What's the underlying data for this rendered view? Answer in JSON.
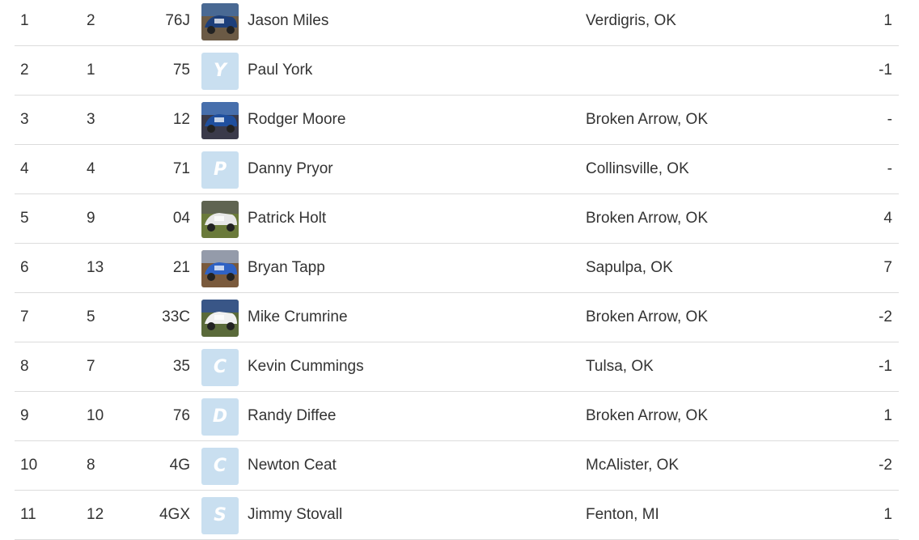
{
  "standings": {
    "rows": [
      {
        "position": "1",
        "previous": "2",
        "car": "76J",
        "avatar_type": "photo",
        "avatar_icon": "car-photo-icon",
        "name": "Jason Miles",
        "hometown": "Verdigris, OK",
        "change": "1"
      },
      {
        "position": "2",
        "previous": "1",
        "car": "75",
        "avatar_type": "letter",
        "avatar_letter": "Y",
        "name": "Paul York",
        "hometown": "",
        "change": "-1"
      },
      {
        "position": "3",
        "previous": "3",
        "car": "12",
        "avatar_type": "photo",
        "avatar_icon": "car-photo-icon",
        "name": "Rodger Moore",
        "hometown": "Broken Arrow, OK",
        "change": "-"
      },
      {
        "position": "4",
        "previous": "4",
        "car": "71",
        "avatar_type": "letter",
        "avatar_letter": "P",
        "name": "Danny Pryor",
        "hometown": "Collinsville, OK",
        "change": "-"
      },
      {
        "position": "5",
        "previous": "9",
        "car": "04",
        "avatar_type": "photo",
        "avatar_icon": "car-photo-icon",
        "name": "Patrick Holt",
        "hometown": "Broken Arrow, OK",
        "change": "4"
      },
      {
        "position": "6",
        "previous": "13",
        "car": "21",
        "avatar_type": "photo",
        "avatar_icon": "car-photo-icon",
        "name": "Bryan Tapp",
        "hometown": "Sapulpa, OK",
        "change": "7"
      },
      {
        "position": "7",
        "previous": "5",
        "car": "33C",
        "avatar_type": "photo",
        "avatar_icon": "car-photo-icon",
        "name": "Mike Crumrine",
        "hometown": "Broken Arrow, OK",
        "change": "-2"
      },
      {
        "position": "8",
        "previous": "7",
        "car": "35",
        "avatar_type": "letter",
        "avatar_letter": "C",
        "name": "Kevin Cummings",
        "hometown": "Tulsa, OK",
        "change": "-1"
      },
      {
        "position": "9",
        "previous": "10",
        "car": "76",
        "avatar_type": "letter",
        "avatar_letter": "D",
        "name": "Randy Diffee",
        "hometown": "Broken Arrow, OK",
        "change": "1"
      },
      {
        "position": "10",
        "previous": "8",
        "car": "4G",
        "avatar_type": "letter",
        "avatar_letter": "C",
        "name": "Newton Ceat",
        "hometown": "McAlister, OK",
        "change": "-2"
      },
      {
        "position": "11",
        "previous": "12",
        "car": "4GX",
        "avatar_type": "letter",
        "avatar_letter": "S",
        "name": "Jimmy Stovall",
        "hometown": "Fenton, MI",
        "change": "1"
      }
    ]
  },
  "colors": {
    "text": "#333333",
    "row_divider": "#dcdcdc",
    "letter_avatar_bg": "#c9dff0",
    "letter_avatar_fg": "#ffffff"
  }
}
